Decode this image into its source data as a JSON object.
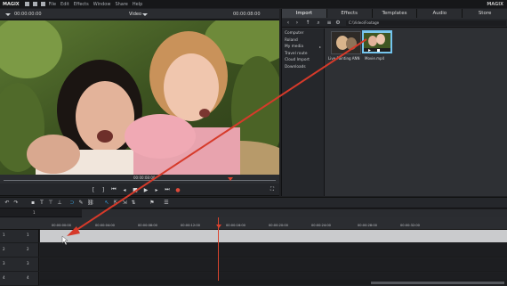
{
  "menubar": {
    "brand": "MAGIX",
    "items": [
      "File",
      "Edit",
      "Effects",
      "Window",
      "Share",
      "Help"
    ],
    "brand_right": "MAGIX"
  },
  "preview": {
    "timecode_left": "00:00:00:00",
    "timecode_right": "00:00:08:00",
    "title": "Video",
    "scrub_position": "00:00:08:00"
  },
  "media_pool": {
    "tabs": [
      "Import",
      "Effects",
      "Templates",
      "Audio",
      "Store"
    ],
    "active_tab": "Import",
    "path": "C:\\Video\\Footage",
    "nav_items": [
      {
        "label": "Computer"
      },
      {
        "label": "Roland"
      },
      {
        "label": "My media",
        "has_arrow": true
      },
      {
        "label": "Travel route"
      },
      {
        "label": "Cloud Import"
      },
      {
        "label": "Downloads"
      }
    ],
    "files": [
      {
        "label": "Live Painting ANN",
        "selected": false
      },
      {
        "label": "Movie.mp4",
        "selected": true
      }
    ]
  },
  "timeline": {
    "tab_number": "1",
    "ruler_ticks": [
      "00:00:00:00",
      "00:00:04:00",
      "00:00:08:00",
      "00:00:12:00",
      "00:00:16:00",
      "00:00:20:00",
      "00:00:24:00",
      "00:00:28:00",
      "00:00:32:00"
    ],
    "tracks": [
      {
        "num": "1",
        "num2": "1"
      },
      {
        "num": "2",
        "num2": "2"
      },
      {
        "num": "3",
        "num2": "3"
      },
      {
        "num": "4",
        "num2": "4"
      }
    ]
  },
  "colors": {
    "accent": "#37a6e6",
    "playhead": "#e0412e",
    "drag_arrow": "#d63a2a"
  }
}
